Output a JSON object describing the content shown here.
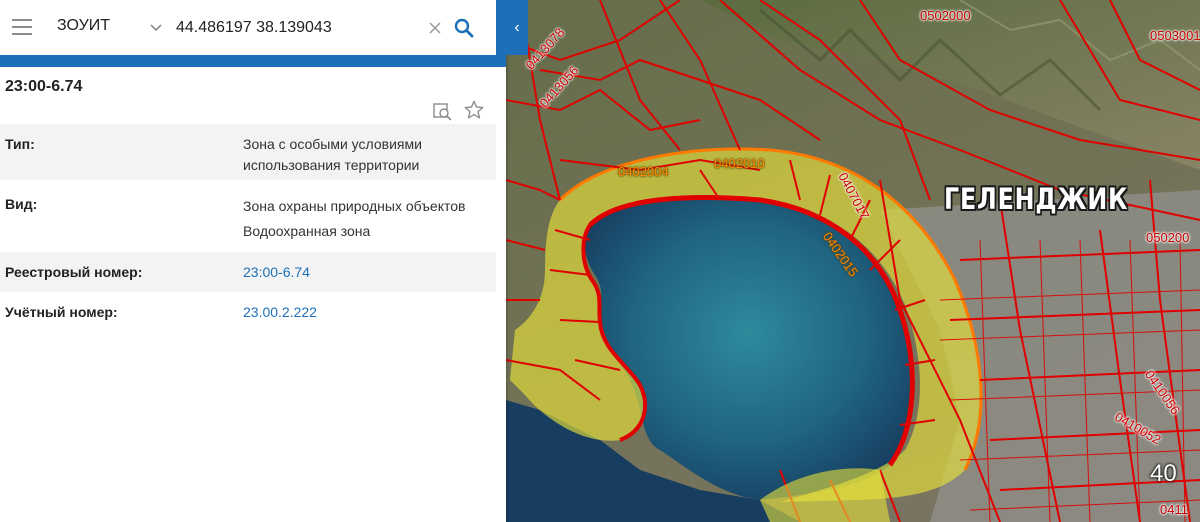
{
  "search": {
    "layer": "ЗОУИТ",
    "query": "44.486197 38.139043"
  },
  "feature": {
    "title": "23:00-6.74",
    "attributes": [
      {
        "label": "Тип:",
        "lines": [
          "Зона с особыми условиями",
          "использования территории"
        ],
        "link": false
      },
      {
        "label": "Вид:",
        "lines": [
          "Зона охраны природных объектов",
          "Водоохранная зона"
        ],
        "link": false
      },
      {
        "label": "Реестровый номер:",
        "lines": [
          "23:00-6.74"
        ],
        "link": true
      },
      {
        "label": "Учётный номер:",
        "lines": [
          "23.00.2.222"
        ],
        "link": true
      }
    ]
  },
  "map": {
    "city_label": "ГЕЛЕНДЖИК",
    "corner_number": "40",
    "parcel_labels": [
      {
        "text": "0502000"
      },
      {
        "text": "0503001"
      },
      {
        "text": "0413078"
      },
      {
        "text": "0413056"
      },
      {
        "text": "0402004"
      },
      {
        "text": "0402010"
      },
      {
        "text": "0407017"
      },
      {
        "text": "0402015"
      },
      {
        "text": "050200"
      },
      {
        "text": "0410056"
      },
      {
        "text": "0410052"
      },
      {
        "text": "0411"
      }
    ],
    "colors": {
      "cadastral_line": "#e00000",
      "zone_fill": "#e6e13a",
      "water": "#1f5e7e",
      "accent": "#1d70b8"
    }
  },
  "icons": [
    "menu-icon",
    "chevron-down-icon",
    "clear-icon",
    "search-icon",
    "find-on-map-icon",
    "star-icon",
    "collapse-arrow-icon"
  ]
}
